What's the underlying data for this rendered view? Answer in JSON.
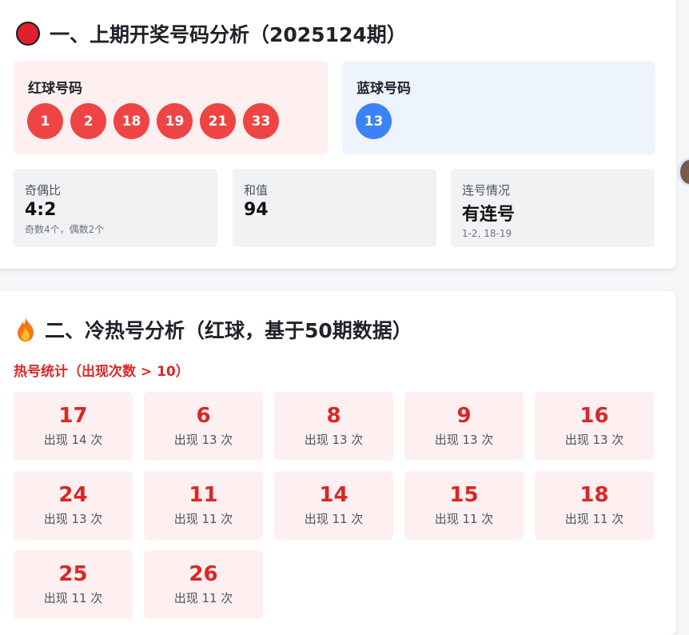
{
  "section1": {
    "title": "一、上期开奖号码分析（2025124期）",
    "red_label": "红球号码",
    "red_balls": [
      "1",
      "2",
      "18",
      "19",
      "21",
      "33"
    ],
    "blue_label": "蓝球号码",
    "blue_balls": [
      "13"
    ],
    "stats": {
      "odd_even": {
        "label": "奇偶比",
        "value": "4:2",
        "note": "奇数4个，偶数2个"
      },
      "sum": {
        "label": "和值",
        "value": "94"
      },
      "consecutive": {
        "label": "连号情况",
        "value": "有连号",
        "note": "1-2, 18-19"
      }
    }
  },
  "section2": {
    "title": "二、冷热号分析（红球，基于50期数据）",
    "hot_heading": "热号统计（出现次数 > 10）",
    "hot_numbers": [
      {
        "number": "17",
        "count": "出现 14 次"
      },
      {
        "number": "6",
        "count": "出现 13 次"
      },
      {
        "number": "8",
        "count": "出现 13 次"
      },
      {
        "number": "9",
        "count": "出现 13 次"
      },
      {
        "number": "16",
        "count": "出现 13 次"
      },
      {
        "number": "24",
        "count": "出现 13 次"
      },
      {
        "number": "11",
        "count": "出现 11 次"
      },
      {
        "number": "14",
        "count": "出现 11 次"
      },
      {
        "number": "15",
        "count": "出现 11 次"
      },
      {
        "number": "18",
        "count": "出现 11 次"
      },
      {
        "number": "25",
        "count": "出现 11 次"
      },
      {
        "number": "26",
        "count": "出现 11 次"
      }
    ]
  },
  "icons": {
    "section1_icon": "red-circle-icon",
    "section2_icon": "flame-icon"
  },
  "colors": {
    "red_ball": "#ef4444",
    "blue_ball": "#3b82f6",
    "hot_text": "#dc2626"
  }
}
